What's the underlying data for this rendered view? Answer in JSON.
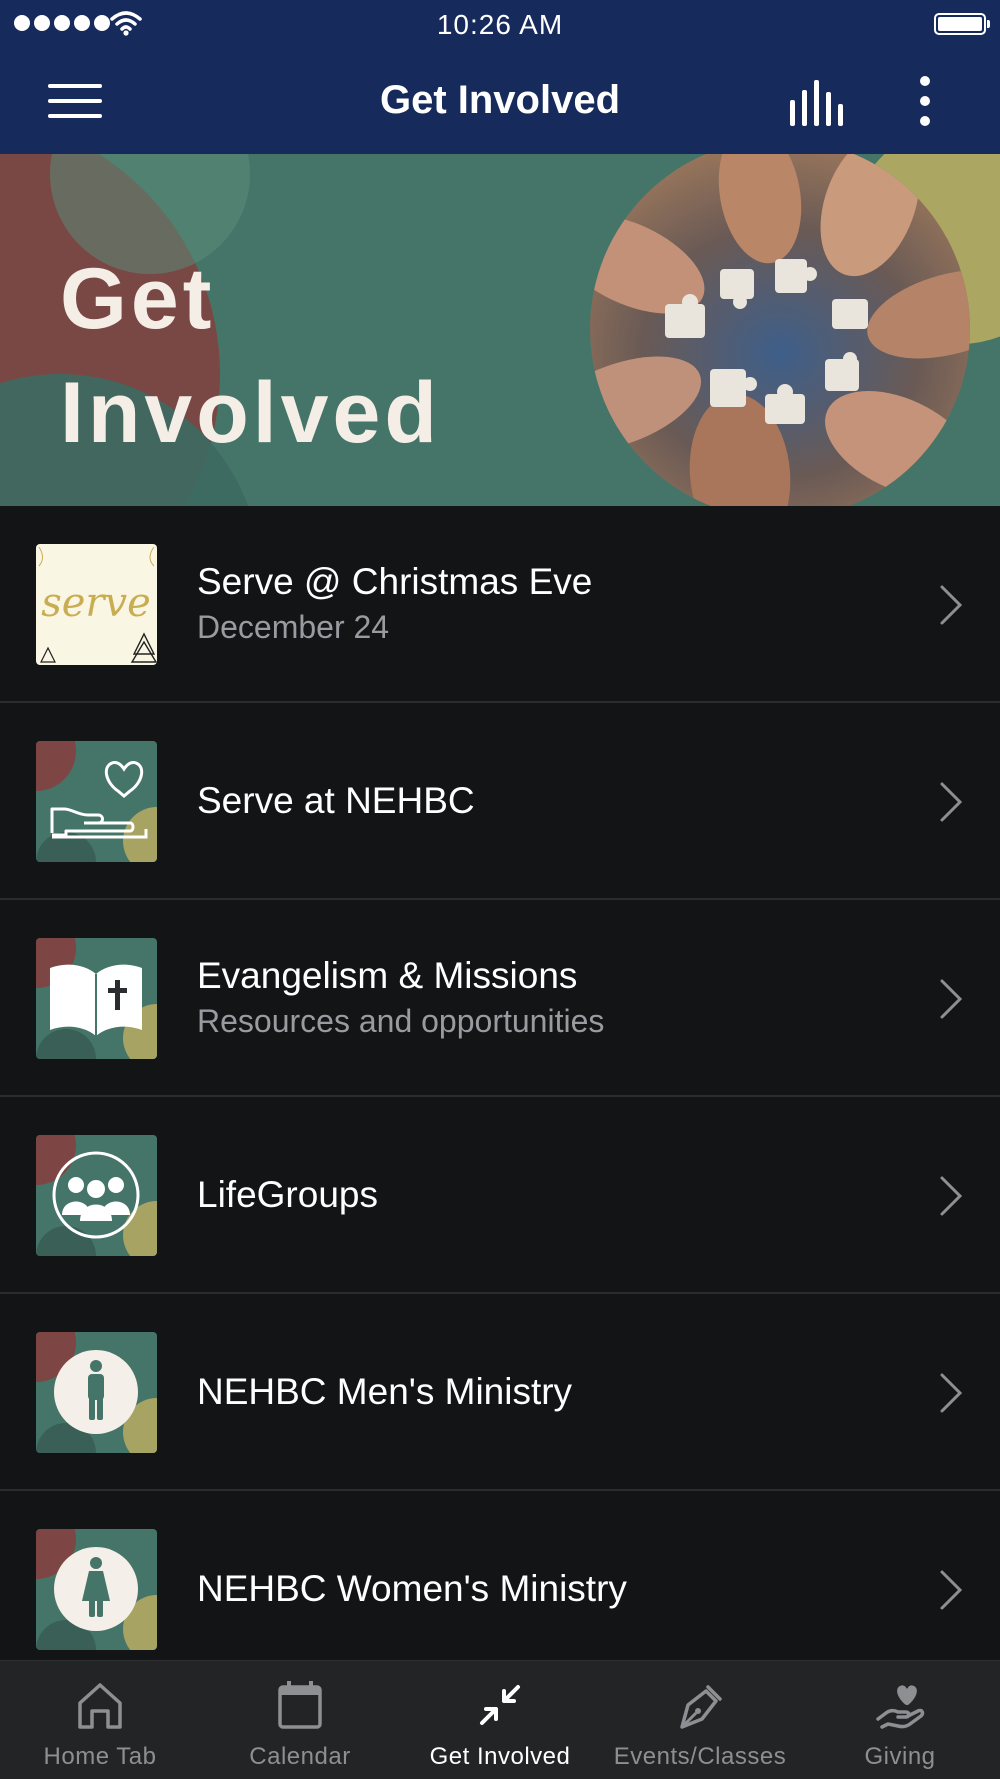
{
  "status_bar": {
    "time": "10:26 AM"
  },
  "app_bar": {
    "title": "Get Involved"
  },
  "banner": {
    "line1": "Get",
    "line2": "Involved"
  },
  "list": {
    "items": [
      {
        "title": "Serve @ Christmas Eve",
        "subtitle": "December 24",
        "thumb_icon": "serve-christmas-thumbnail",
        "thumb_text": "serve"
      },
      {
        "title": "Serve at NEHBC",
        "subtitle": "",
        "thumb_icon": "hand-heart-icon"
      },
      {
        "title": "Evangelism & Missions",
        "subtitle": "Resources and opportunities",
        "thumb_icon": "bible-cross-icon"
      },
      {
        "title": "LifeGroups",
        "subtitle": "",
        "thumb_icon": "group-people-icon"
      },
      {
        "title": "NEHBC Men's Ministry",
        "subtitle": "",
        "thumb_icon": "man-icon"
      },
      {
        "title": "NEHBC Women's Ministry",
        "subtitle": "",
        "thumb_icon": "woman-icon"
      }
    ]
  },
  "tab_bar": {
    "tabs": [
      {
        "label": "Home Tab",
        "icon": "home-icon",
        "active": false
      },
      {
        "label": "Calendar",
        "icon": "calendar-icon",
        "active": false
      },
      {
        "label": "Get Involved",
        "icon": "arrows-inward-icon",
        "active": true
      },
      {
        "label": "Events/Classes",
        "icon": "pen-nib-icon",
        "active": false
      },
      {
        "label": "Giving",
        "icon": "hand-heart-icon",
        "active": false
      }
    ]
  },
  "colors": {
    "header_bg": "#172a5c",
    "list_bg": "#131416",
    "tab_bar_bg": "#232426",
    "banner_teal": "#457569",
    "subtitle_gray": "#9a9ba0"
  }
}
